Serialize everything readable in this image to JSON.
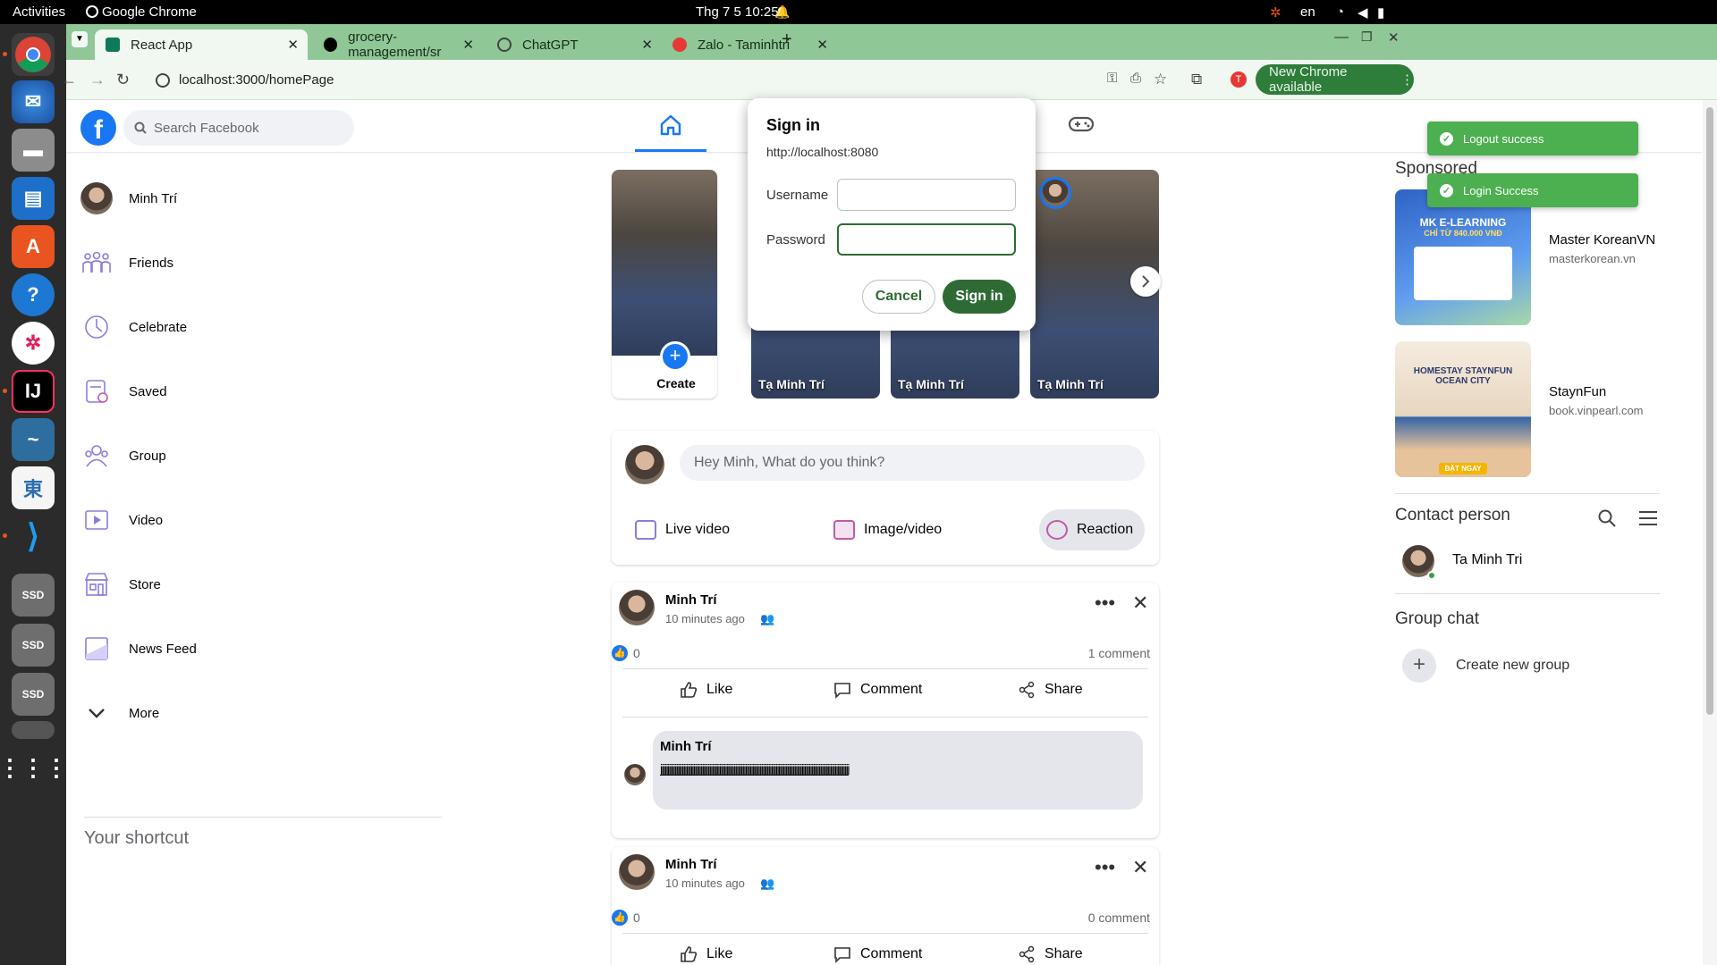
{
  "system": {
    "activities": "Activities",
    "app_name": "Google Chrome",
    "clock": "Thg 7 5  10:25",
    "lang": "en"
  },
  "tabs": [
    {
      "label": "React App",
      "icon_color": "#0e7a5a"
    },
    {
      "label": "grocery-management/sr",
      "icon_color": "#000000"
    },
    {
      "label": "ChatGPT",
      "icon_color": "#444444"
    },
    {
      "label": "Zalo - Taminhtri",
      "icon_color": "#e53935"
    }
  ],
  "browser": {
    "url": "localhost:3000/homePage",
    "new_chrome": "New Chrome available",
    "profile_initial": "T"
  },
  "fb": {
    "logo": "f",
    "search_placeholder": "Search Facebook"
  },
  "left_nav": [
    {
      "label": "Minh Trí",
      "icon": "avatar"
    },
    {
      "label": "Friends",
      "icon": "friends-icon"
    },
    {
      "label": "Celebrate",
      "icon": "celebrate-icon"
    },
    {
      "label": "Saved",
      "icon": "saved-icon"
    },
    {
      "label": "Group",
      "icon": "group-icon"
    },
    {
      "label": "Video",
      "icon": "video-icon"
    },
    {
      "label": "Store",
      "icon": "store-icon"
    },
    {
      "label": "News Feed",
      "icon": "news-feed-icon"
    },
    {
      "label": "More",
      "icon": "chevron-down-icon"
    }
  ],
  "shortcut_title": "Your shortcut",
  "stories": {
    "create_label": "Create",
    "items": [
      "Tạ Minh Trí",
      "Tạ Minh Trí",
      "Tạ Minh Trí"
    ]
  },
  "composer": {
    "placeholder": "Hey Minh, What do you think?",
    "live_video": "Live video",
    "image_video": "Image/video",
    "reaction": "Reaction"
  },
  "posts": [
    {
      "author": "Minh Trí",
      "time": "10 minutes ago",
      "likes": "0",
      "comments": "1 comment",
      "like_label": "Like",
      "comment_label": "Comment",
      "share_label": "Share",
      "comment": {
        "author": "Minh Trí",
        "text": "jjjjjjjjjjjjjjjjjjjjjjjjjjjjjjjjjjjjjjjjjjjjjjjjjjjjjjjjjjjjjjjjjjjjjjjjjjjjjjjjjjjjjjjjjjjjjjjjjjjjjjjjjjjjjjjjjjjjjjjjjjjjjjjjjjj"
      }
    },
    {
      "author": "Minh Trí",
      "time": "10 minutes ago",
      "likes": "0",
      "comments": "0 comment",
      "like_label": "Like",
      "comment_label": "Comment",
      "share_label": "Share"
    }
  ],
  "sponsored": {
    "title": "Sponsored",
    "ads": [
      {
        "name": "Master KoreanVN",
        "site": "masterkorean.vn",
        "image_text": "MK E-LEARNING",
        "image_sub": "CHỈ TỪ 840.000 VNĐ",
        "color": "#3b6fd6"
      },
      {
        "name": "StaynFun",
        "site": "book.vinpearl.com",
        "image_text": "HOMESTAY STAYNFUN OCEAN CITY",
        "image_sub": "ĐẶT NGAY",
        "color": "#f3e6d6"
      }
    ]
  },
  "contacts": {
    "title": "Contact person",
    "items": [
      {
        "name": "Ta Minh Tri"
      }
    ]
  },
  "group_chat": {
    "title": "Group chat",
    "create": "Create new group"
  },
  "toasts": [
    "Logout success",
    "Login Success"
  ],
  "sign_in": {
    "title": "Sign in",
    "origin": "http://localhost:8080",
    "username_label": "Username",
    "password_label": "Password",
    "username_value": "",
    "password_value": "",
    "cancel": "Cancel",
    "submit": "Sign in"
  },
  "colors": {
    "fb_blue": "#1877f2",
    "chrome_tab_bar": "#8fc796",
    "chrome_toolbar": "#f1f7f1",
    "toast_green": "#4caf50",
    "sign_in_green": "#2e6b34"
  }
}
